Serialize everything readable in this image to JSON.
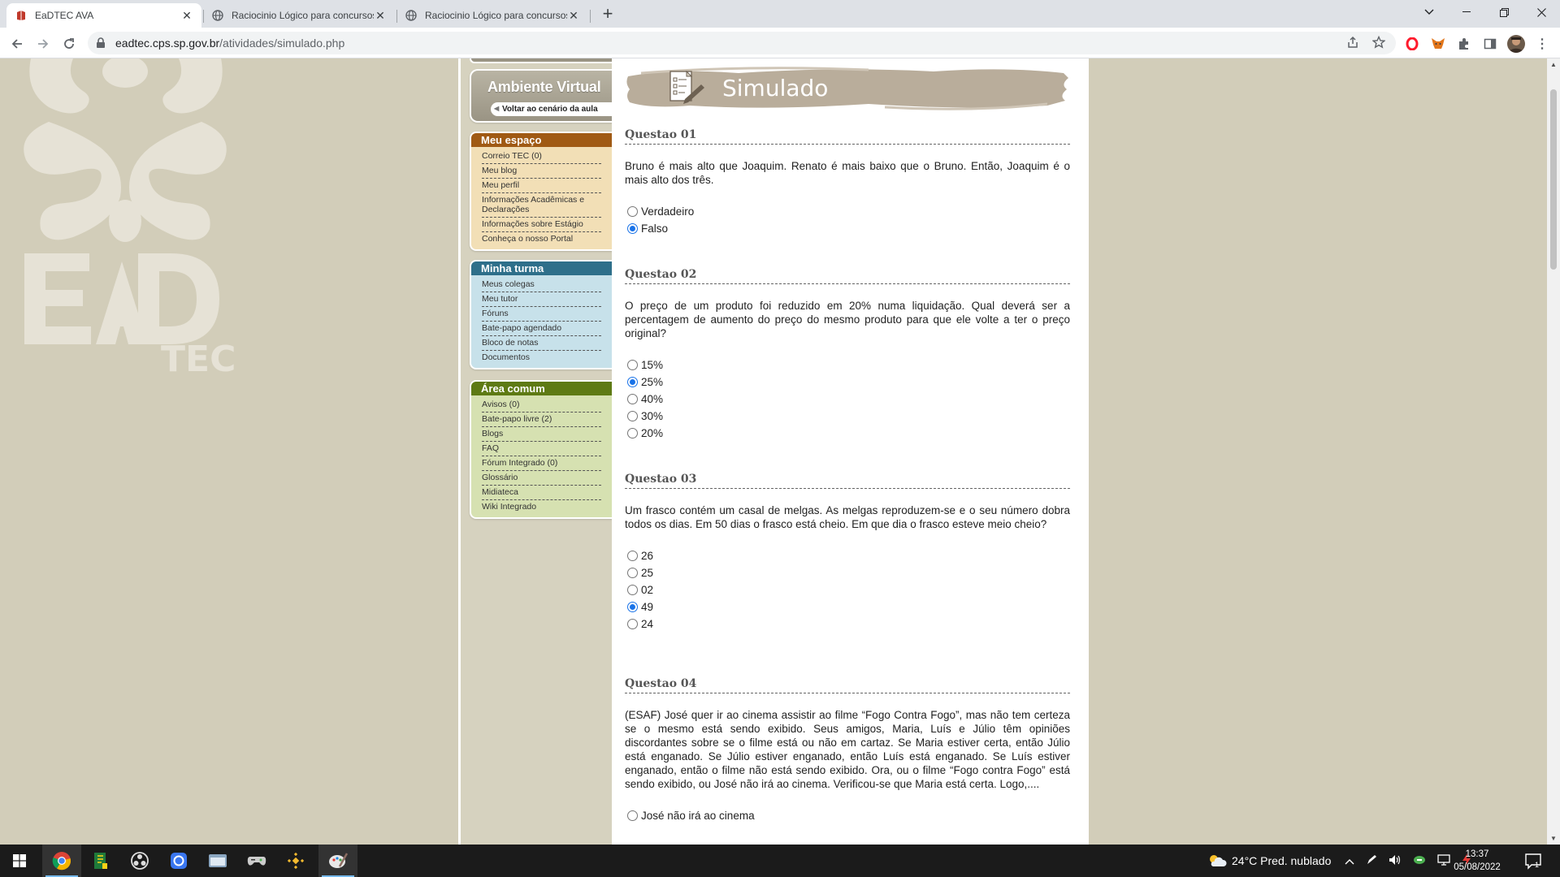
{
  "browser": {
    "tabs": [
      {
        "title": "EaDTEC AVA",
        "active": true
      },
      {
        "title": "Raciocinio Lógico para concursos",
        "active": false
      },
      {
        "title": "Raciocinio Lógico para concursos",
        "active": false
      }
    ],
    "new_tab_label": "+",
    "url_host": "eadtec.cps.sp.gov.br",
    "url_path": "/atividades/simulado.php"
  },
  "decor": {
    "logo_text": "EaD TEC"
  },
  "sidebar": {
    "ambiente_title": "Ambiente Virtual",
    "ambiente_back": "Voltar ao cenário da aula",
    "meu_espaco": {
      "title": "Meu espaço",
      "items": [
        "Correio TEC (0)",
        "Meu blog",
        "Meu perfil",
        "Informações Acadêmicas e Declarações",
        "Informações sobre Estágio",
        "Conheça o nosso Portal"
      ]
    },
    "minha_turma": {
      "title": "Minha turma",
      "items": [
        "Meus colegas",
        "Meu tutor",
        "Fóruns",
        "Bate-papo agendado",
        "Bloco de notas",
        "Documentos"
      ]
    },
    "area_comum": {
      "title": "Área comum",
      "items": [
        "Avisos (0)",
        "Bate-papo livre (2)",
        "Blogs",
        "FAQ",
        "Fórum Integrado (0)",
        "Glossário",
        "Midiateca",
        "Wiki Integrado"
      ]
    }
  },
  "content": {
    "banner_title": "Simulado",
    "questions": [
      {
        "title": "Questao 01",
        "text": "Bruno é mais alto que Joaquim. Renato é mais baixo que o Bruno. Então, Joaquim é o mais alto dos três.",
        "options": [
          "Verdadeiro",
          "Falso"
        ],
        "selected": 1
      },
      {
        "title": "Questao 02",
        "text": "O preço de um produto foi reduzido em 20% numa liquidação. Qual deverá ser a percentagem de aumento do preço do mesmo produto para que ele volte a ter o preço original?",
        "options": [
          "15%",
          "25%",
          "40%",
          "30%",
          "20%"
        ],
        "selected": 1
      },
      {
        "title": "Questao 03",
        "text": "Um frasco contém um casal de melgas. As melgas reproduzem-se e o seu número dobra todos os dias. Em 50 dias o frasco está cheio. Em que dia o frasco esteve meio cheio?",
        "options": [
          "26",
          "25",
          "02",
          "49",
          "24"
        ],
        "selected": 3
      },
      {
        "title": "Questao 04",
        "text": "(ESAF) José quer ir ao cinema assistir ao filme “Fogo Contra Fogo”, mas não tem certeza se o mesmo está sendo exibido. Seus amigos, Maria, Luís e Júlio têm opiniões discordantes sobre se o filme está ou não em cartaz. Se Maria estiver certa, então Júlio está enganado. Se Júlio estiver enganado, então Luís está enganado. Se Luís estiver enganado, então o filme não está sendo exibido. Ora, ou o filme “Fogo contra Fogo” está sendo exibido, ou José não irá ao cinema. Verificou-se que Maria está certa. Logo,....",
        "options": [
          "José não irá ao cinema"
        ],
        "selected": -1
      }
    ]
  },
  "taskbar": {
    "weather": "24°C  Pred. nublado",
    "time": "13:37",
    "date": "05/08/2022",
    "notification_count": "1"
  }
}
